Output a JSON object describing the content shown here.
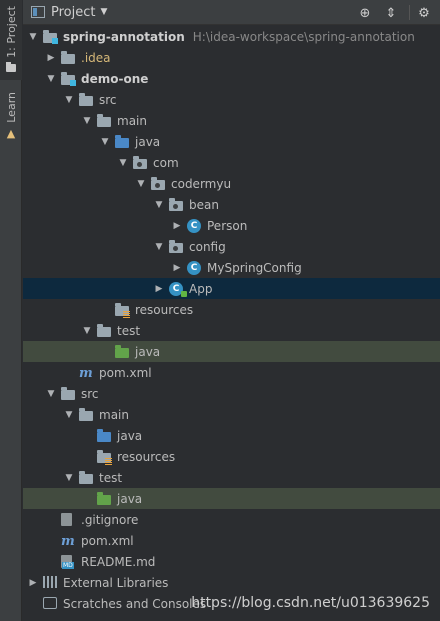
{
  "sidebar": {
    "project_tab": "1: Project",
    "learn_tab": "Learn"
  },
  "header": {
    "title": "Project",
    "buttons": [
      "target-icon",
      "collapse-icon",
      "gear-icon"
    ]
  },
  "tree": [
    {
      "level": 0,
      "arrow": "down",
      "icon": "module-folder",
      "label": "spring-annotation",
      "bold": true,
      "extra": "H:\\idea-workspace\\spring-annotation"
    },
    {
      "level": 1,
      "arrow": "right",
      "icon": "folder-gray",
      "label": ".idea",
      "style": "yellow"
    },
    {
      "level": 1,
      "arrow": "down",
      "icon": "module-folder",
      "label": "demo-one",
      "bold": true
    },
    {
      "level": 2,
      "arrow": "down",
      "icon": "folder-gray",
      "label": "src"
    },
    {
      "level": 3,
      "arrow": "down",
      "icon": "folder-gray",
      "label": "main"
    },
    {
      "level": 4,
      "arrow": "down",
      "icon": "folder-blue",
      "label": "java"
    },
    {
      "level": 5,
      "arrow": "down",
      "icon": "package",
      "label": "com"
    },
    {
      "level": 6,
      "arrow": "down",
      "icon": "package",
      "label": "codermyu"
    },
    {
      "level": 7,
      "arrow": "down",
      "icon": "package",
      "label": "bean"
    },
    {
      "level": 8,
      "arrow": "right",
      "icon": "class",
      "label": "Person"
    },
    {
      "level": 7,
      "arrow": "down",
      "icon": "package",
      "label": "config"
    },
    {
      "level": 8,
      "arrow": "right",
      "icon": "class",
      "label": "MySpringConfig"
    },
    {
      "level": 7,
      "arrow": "right",
      "icon": "class-run",
      "label": "App",
      "highlight": "blue"
    },
    {
      "level": 4,
      "arrow": "none",
      "icon": "folder-resources",
      "label": "resources"
    },
    {
      "level": 3,
      "arrow": "down",
      "icon": "folder-gray",
      "label": "test"
    },
    {
      "level": 4,
      "arrow": "none",
      "icon": "folder-green",
      "label": "java",
      "highlight": "green"
    },
    {
      "level": 2,
      "arrow": "none",
      "icon": "maven",
      "label": "pom.xml"
    },
    {
      "level": 1,
      "arrow": "down",
      "icon": "folder-gray",
      "label": "src"
    },
    {
      "level": 2,
      "arrow": "down",
      "icon": "folder-gray",
      "label": "main"
    },
    {
      "level": 3,
      "arrow": "none",
      "icon": "folder-blue",
      "label": "java"
    },
    {
      "level": 3,
      "arrow": "none",
      "icon": "folder-resources",
      "label": "resources"
    },
    {
      "level": 2,
      "arrow": "down",
      "icon": "folder-gray",
      "label": "test"
    },
    {
      "level": 3,
      "arrow": "none",
      "icon": "folder-green",
      "label": "java",
      "highlight": "green"
    },
    {
      "level": 1,
      "arrow": "none",
      "icon": "file-gitignore",
      "label": ".gitignore"
    },
    {
      "level": 1,
      "arrow": "none",
      "icon": "maven",
      "label": "pom.xml"
    },
    {
      "level": 1,
      "arrow": "none",
      "icon": "file-md",
      "label": "README.md"
    },
    {
      "level": 0,
      "arrow": "right",
      "icon": "libraries",
      "label": "External Libraries"
    },
    {
      "level": 0,
      "arrow": "none",
      "icon": "scratches",
      "label": "Scratches and Consoles"
    }
  ],
  "watermark": "https://blog.csdn.net/u013639625",
  "colors": {
    "background": "#2b2d30",
    "selection_blue": "#0d293e",
    "highlight_green": "#424b3f",
    "text": "#bbbbbb",
    "folder_blue": "#4a88c7",
    "folder_green": "#62a34a"
  }
}
